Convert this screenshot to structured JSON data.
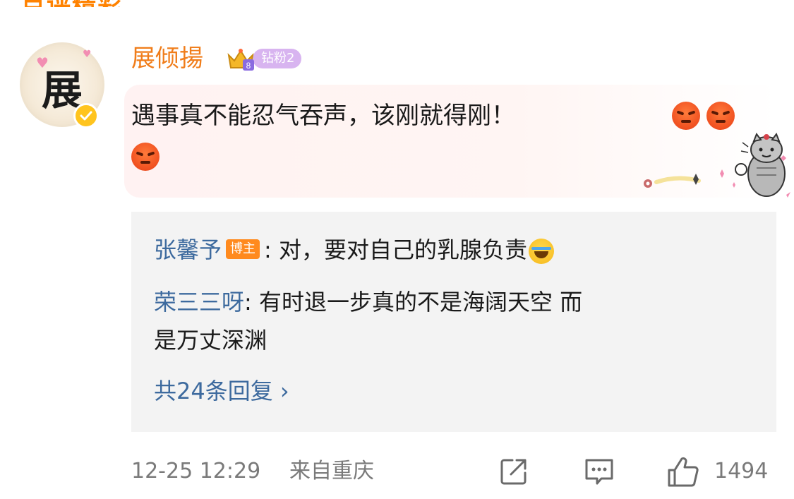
{
  "top_partial_text": "点评精彩",
  "comment": {
    "author": "展倾揚",
    "avatar_char": "展",
    "fan_badge": "钻粉2",
    "text": "遇事真不能忍气吞声，该刚就得刚！",
    "emojis": [
      "angry-emoji",
      "angry-emoji",
      "angry-emoji"
    ]
  },
  "replies": [
    {
      "author": "张馨予",
      "tag": "博主",
      "text": ": 对，要对自己的乳腺负责"
    },
    {
      "author": "荣三三呀",
      "text_line1": ": 有时退一步真的不是海阔天空 而",
      "text_line2": "是万丈深渊"
    }
  ],
  "total_replies": "共24条回复 ›",
  "meta": {
    "date": "12-25 12:29",
    "location": "来自重庆",
    "like_count": "1494"
  },
  "colors": {
    "author_orange": "#f07d1a",
    "reply_blue": "#3d6a9e",
    "fan_badge_purple": "#d8b4f0",
    "blogger_tag_orange": "#ff8a1e"
  }
}
